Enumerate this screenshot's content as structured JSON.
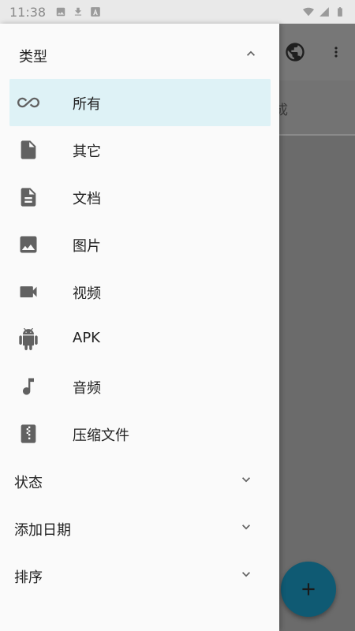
{
  "status_bar": {
    "time": "11:38",
    "icons_left": [
      "image-icon",
      "download-icon",
      "a-icon"
    ],
    "icons_right": [
      "wifi-icon",
      "signal-icon",
      "battery-icon"
    ]
  },
  "background_app": {
    "toolbar_icons": [
      "globe-icon",
      "more-vert-icon"
    ],
    "tab_partial_text": "成",
    "fab_label": "+"
  },
  "drawer": {
    "type_section": {
      "title": "类型",
      "expanded": true,
      "items": [
        {
          "label": "所有",
          "icon": "infinity-icon",
          "selected": true
        },
        {
          "label": "其它",
          "icon": "file-icon",
          "selected": false
        },
        {
          "label": "文档",
          "icon": "document-icon",
          "selected": false
        },
        {
          "label": "图片",
          "icon": "image-icon",
          "selected": false
        },
        {
          "label": "视频",
          "icon": "videocam-icon",
          "selected": false
        },
        {
          "label": "APK",
          "icon": "android-icon",
          "selected": false
        },
        {
          "label": "音频",
          "icon": "music-note-icon",
          "selected": false
        },
        {
          "label": "压缩文件",
          "icon": "zip-icon",
          "selected": false
        }
      ]
    },
    "collapsed_sections": [
      {
        "title": "状态",
        "expanded": false
      },
      {
        "title": "添加日期",
        "expanded": false
      },
      {
        "title": "排序",
        "expanded": false
      }
    ]
  },
  "colors": {
    "drawer_bg": "#fafafa",
    "selected_bg": "#def2f6",
    "icon_gray": "#616161",
    "fab": "#0f5a73"
  }
}
